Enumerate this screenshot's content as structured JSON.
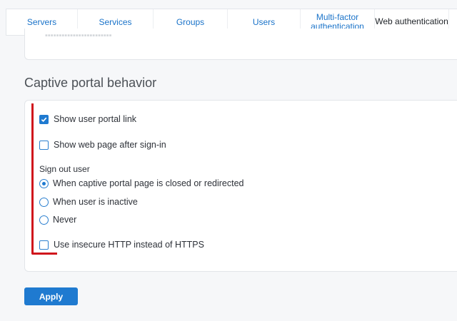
{
  "tabs": [
    {
      "label": "Servers"
    },
    {
      "label": "Services"
    },
    {
      "label": "Groups"
    },
    {
      "label": "Users"
    },
    {
      "label": "Multi-factor authentication"
    },
    {
      "label": "Web authentication"
    }
  ],
  "section": {
    "title": "Captive portal behavior"
  },
  "options": {
    "show_portal_link": {
      "label": "Show user portal link",
      "checked": true
    },
    "show_web_page": {
      "label": "Show web page after sign-in",
      "checked": false
    },
    "sign_out_label": "Sign out user",
    "sign_out_choices": [
      {
        "label": "When captive portal page is closed or redirected",
        "selected": true
      },
      {
        "label": "When user is inactive",
        "selected": false
      },
      {
        "label": "Never",
        "selected": false
      }
    ],
    "insecure_http": {
      "label": "Use insecure HTTP instead of HTTPS",
      "checked": false
    }
  },
  "apply_label": "Apply",
  "colors": {
    "accent": "#1f7ad0",
    "annotation": "#d0141c"
  }
}
